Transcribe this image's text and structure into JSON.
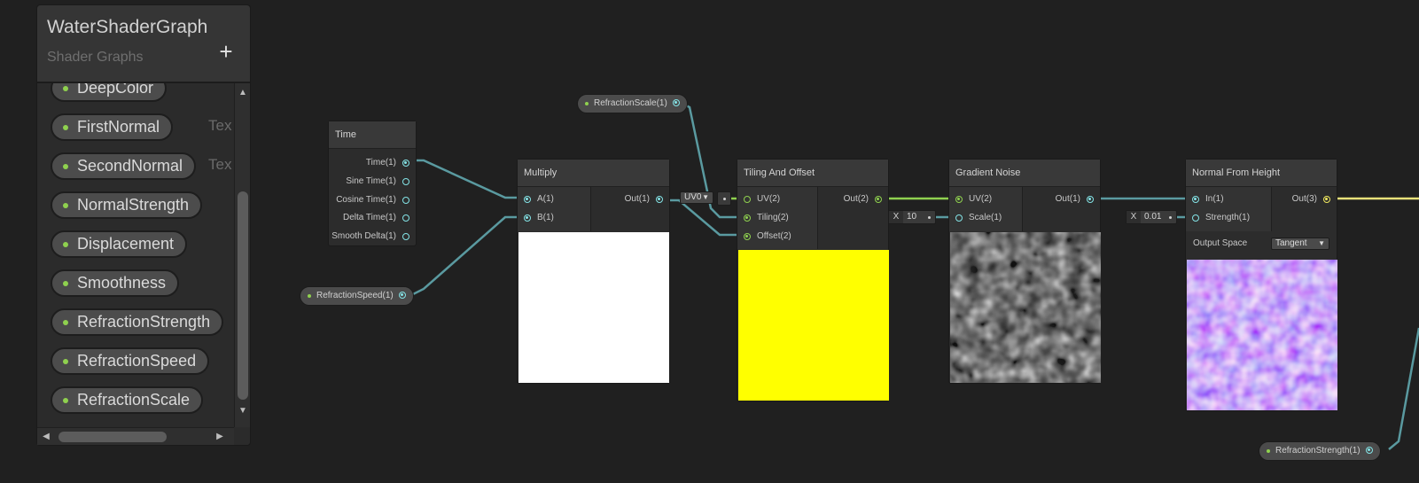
{
  "blackboard": {
    "title": "WaterShaderGraph",
    "subtitle": "Shader Graphs",
    "add_label": "+",
    "properties": [
      {
        "name": "DeepColor",
        "type": ""
      },
      {
        "name": "FirstNormal",
        "type": "Tex"
      },
      {
        "name": "SecondNormal",
        "type": "Tex"
      },
      {
        "name": "NormalStrength",
        "type": ""
      },
      {
        "name": "Displacement",
        "type": ""
      },
      {
        "name": "Smoothness",
        "type": ""
      },
      {
        "name": "RefractionStrength",
        "type": ""
      },
      {
        "name": "RefractionSpeed",
        "type": ""
      },
      {
        "name": "RefractionScale",
        "type": ""
      }
    ],
    "scroll_up": "▲",
    "scroll_down": "▼",
    "scroll_left": "◀",
    "scroll_right": "▶"
  },
  "nodes": {
    "time": {
      "title": "Time",
      "outputs": [
        "Time(1)",
        "Sine Time(1)",
        "Cosine Time(1)",
        "Delta Time(1)",
        "Smooth Delta(1)"
      ]
    },
    "multiply": {
      "title": "Multiply",
      "inputs": [
        "A(1)",
        "B(1)"
      ],
      "outputs": [
        "Out(1)"
      ],
      "preview_color": "#ffffff"
    },
    "tiling": {
      "title": "Tiling And Offset",
      "inputs": [
        "UV(2)",
        "Tiling(2)",
        "Offset(2)"
      ],
      "outputs": [
        "Out(2)"
      ],
      "uv_dropdown": "UV0",
      "preview_color": "#ffff00"
    },
    "noise": {
      "title": "Gradient Noise",
      "inputs": [
        "UV(2)",
        "Scale(1)"
      ],
      "outputs": [
        "Out(1)"
      ],
      "scale_axis": "X",
      "scale_value": "10"
    },
    "normal": {
      "title": "Normal From Height",
      "inputs": [
        "In(1)",
        "Strength(1)"
      ],
      "outputs": [
        "Out(3)"
      ],
      "strength_axis": "X",
      "strength_value": "0.01",
      "output_space_label": "Output Space",
      "output_space_value": "Tangent"
    }
  },
  "graph_properties": {
    "refraction_scale": "RefractionScale(1)",
    "refraction_speed": "RefractionSpeed(1)",
    "refraction_strength": "RefractionStrength(1)"
  },
  "colors": {
    "wire_float": "#5a9aa0",
    "wire_vec2": "#8fd14f",
    "wire_vec3": "#e8e27a",
    "property_dot": "#8fd14f"
  }
}
